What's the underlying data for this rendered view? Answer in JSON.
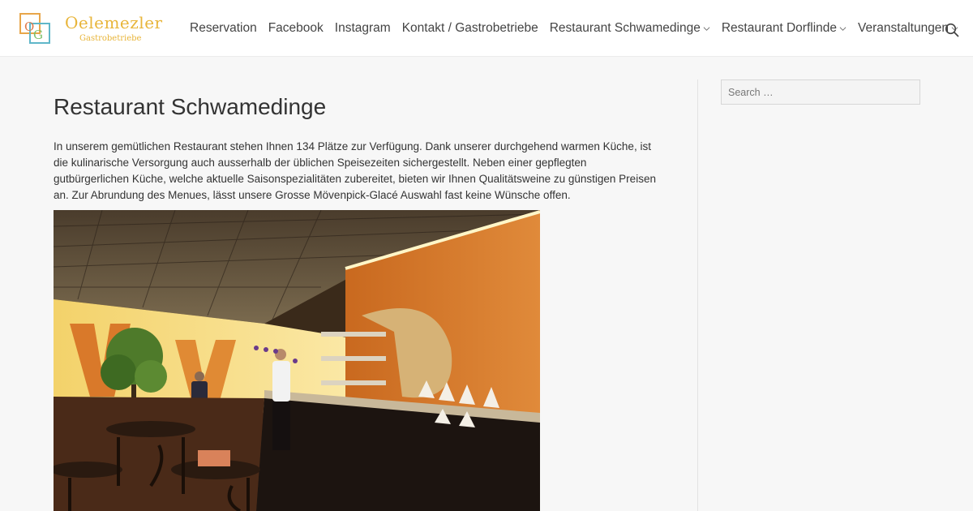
{
  "logo": {
    "mark_text": "OG",
    "title": "Oelemezler",
    "subtitle": "Gastrobetriebe"
  },
  "nav": {
    "items": [
      {
        "label": "Reservation",
        "has_dropdown": false
      },
      {
        "label": "Facebook",
        "has_dropdown": false
      },
      {
        "label": "Instagram",
        "has_dropdown": false
      },
      {
        "label": "Kontakt / Gastrobetriebe",
        "has_dropdown": false
      },
      {
        "label": "Restaurant Schwamedinge",
        "has_dropdown": true
      },
      {
        "label": "Restaurant Dorflinde",
        "has_dropdown": true
      },
      {
        "label": "Veranstaltungen",
        "has_dropdown": true
      }
    ],
    "search_icon": "search-icon"
  },
  "main": {
    "title": "Restaurant Schwamedinge",
    "intro": "In unserem gemütlichen Restaurant stehen Ihnen 134 Plätze zur Verfügung. Dank unserer durchgehend warmen Küche, ist die kulinarische Versorgung auch ausserhalb der üblichen Speisezeiten sichergestellt. Neben einer gepflegten gutbürgerlichen Küche, welche aktuelle Saisonspezialitäten zubereitet, bieten wir Ihnen Qualitätsweine zu günstigen Preisen an. Zur Abrundung des Menues, lässt unsere Grosse Mövenpick-Glacé Auswahl fast keine Wünsche offen."
  },
  "sidebar": {
    "search_placeholder": "Search …"
  },
  "colors": {
    "brand": "#e8b53a",
    "text": "#333333",
    "background": "#f7f7f7"
  }
}
